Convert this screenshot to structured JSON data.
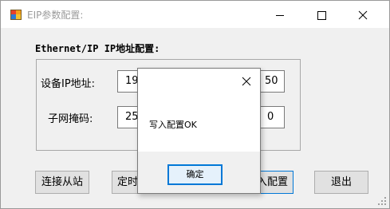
{
  "window": {
    "title": "EIP参数配置:",
    "icon": "app-icon",
    "controls": [
      "minimize-icon",
      "maximize-icon",
      "close-icon"
    ]
  },
  "config_group": {
    "label": "Ethernet/IP IP地址配置:",
    "ip_label": "设备IP地址:",
    "ip_octet_1": "19",
    "ip_octet_4": "50",
    "mask_label": "子网掩码:",
    "mask_octet_1": "25",
    "mask_octet_4": "0"
  },
  "buttons": {
    "connect": "连接从站",
    "timer": "定时",
    "write": "入配置",
    "exit": "退出"
  },
  "dialog": {
    "message": "写入配置OK",
    "ok": "确定"
  },
  "colors": {
    "accent": "#0078d7",
    "window_bg": "#f0f0f0",
    "titlebar_bg": "#ffffff",
    "title_text": "#9b9b9b"
  }
}
